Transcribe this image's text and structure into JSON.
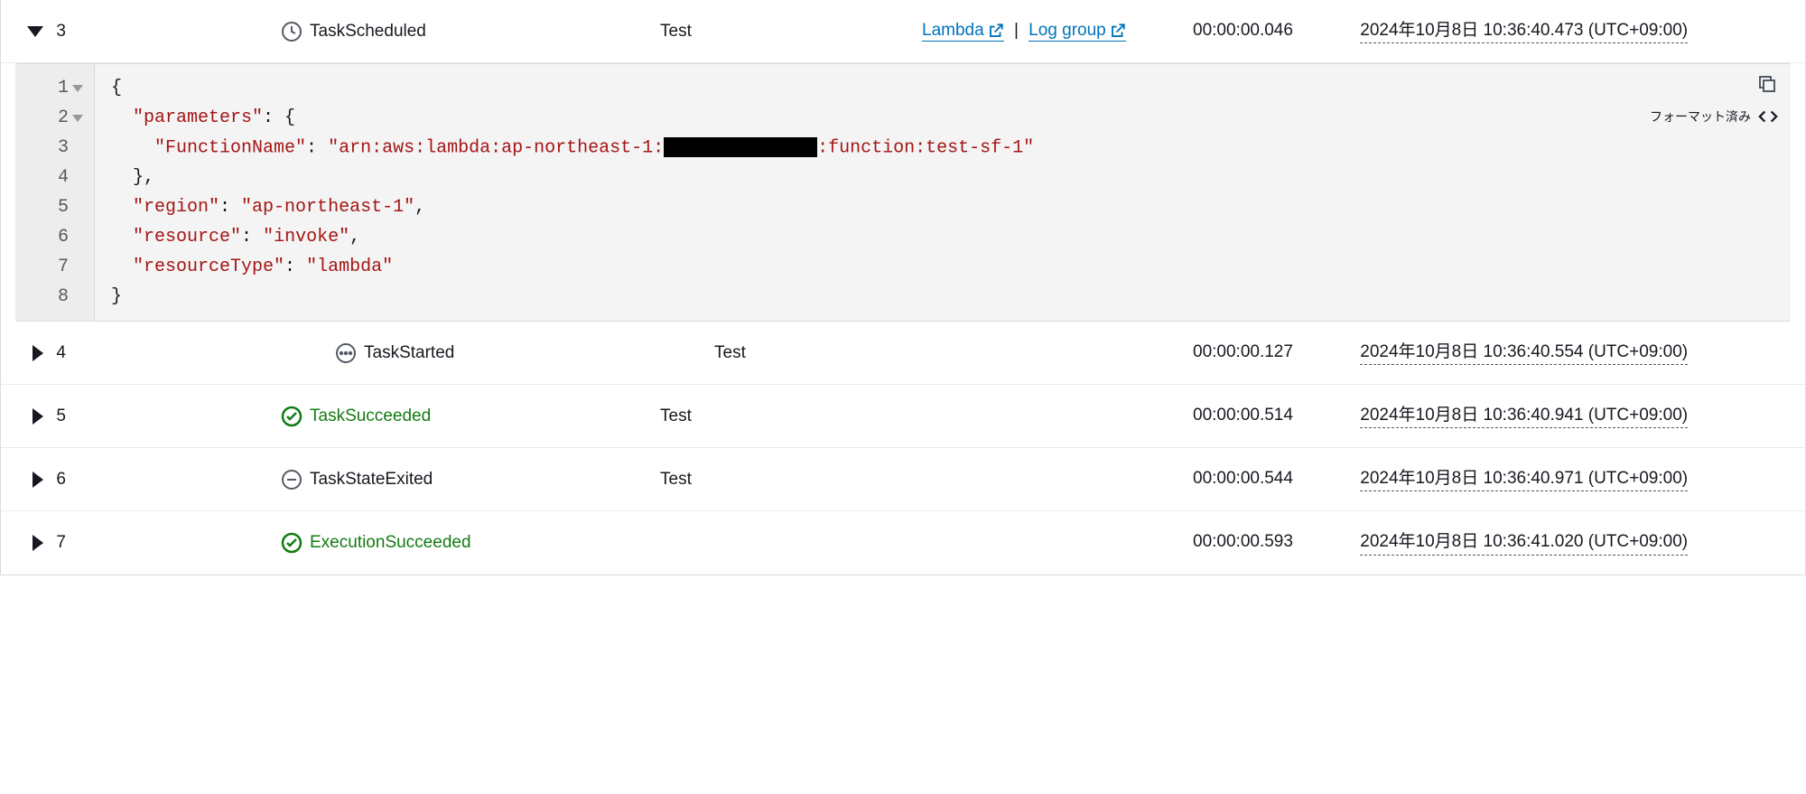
{
  "rows": [
    {
      "idx": "3",
      "expanded": true,
      "icon": "clock",
      "type_label": "TaskScheduled",
      "type_style": "normal",
      "type_offset": false,
      "step": "Test",
      "links": {
        "lambda": "Lambda",
        "sep": "|",
        "loggroup": "Log group"
      },
      "duration": "00:00:00.046",
      "timestamp": "2024年10月8日 10:36:40.473 (UTC+09:00)"
    },
    {
      "idx": "4",
      "expanded": false,
      "icon": "ellipsis",
      "type_label": "TaskStarted",
      "type_style": "normal",
      "type_offset": true,
      "step": "Test",
      "links": null,
      "duration": "00:00:00.127",
      "timestamp": "2024年10月8日 10:36:40.554 (UTC+09:00)"
    },
    {
      "idx": "5",
      "expanded": false,
      "icon": "check",
      "type_label": "TaskSucceeded",
      "type_style": "success",
      "type_offset": false,
      "step": "Test",
      "links": null,
      "duration": "00:00:00.514",
      "timestamp": "2024年10月8日 10:36:40.941 (UTC+09:00)"
    },
    {
      "idx": "6",
      "expanded": false,
      "icon": "minus",
      "type_label": "TaskStateExited",
      "type_style": "normal",
      "type_offset": false,
      "step": "Test",
      "links": null,
      "duration": "00:00:00.544",
      "timestamp": "2024年10月8日 10:36:40.971 (UTC+09:00)"
    },
    {
      "idx": "7",
      "expanded": false,
      "icon": "check",
      "type_label": "ExecutionSucceeded",
      "type_style": "success",
      "type_offset": false,
      "step": "",
      "links": null,
      "duration": "00:00:00.593",
      "timestamp": "2024年10月8日 10:36:41.020 (UTC+09:00)"
    }
  ],
  "code": {
    "gutter": [
      "1",
      "2",
      "3",
      "4",
      "5",
      "6",
      "7",
      "8"
    ],
    "keys": {
      "parameters": "\"parameters\"",
      "FunctionName": "\"FunctionName\"",
      "region": "\"region\"",
      "resource": "\"resource\"",
      "resourceType": "\"resourceType\""
    },
    "values": {
      "arn_prefix": "\"arn:aws:lambda:ap-northeast-1:",
      "arn_suffix": ":function:test-sf-1\"",
      "region": "\"ap-northeast-1\"",
      "resource": "\"invoke\"",
      "resourceType": "\"lambda\""
    },
    "format_label": "フォーマット済み"
  }
}
